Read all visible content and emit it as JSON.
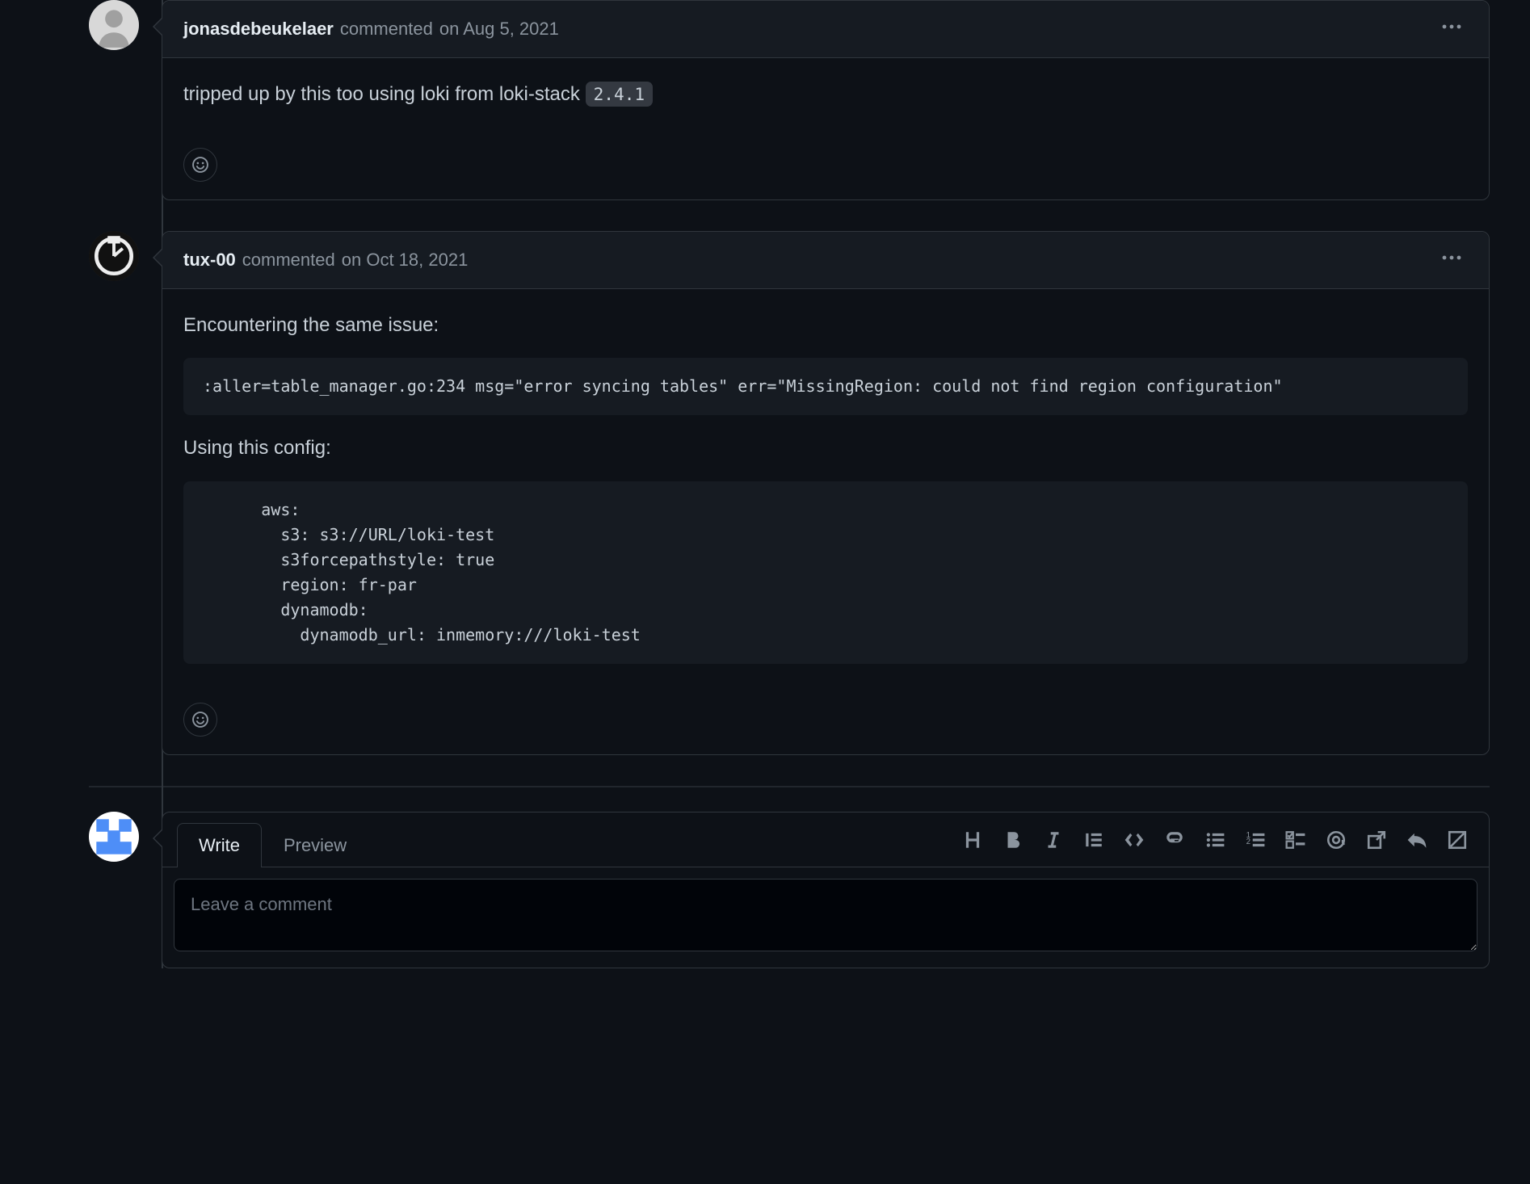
{
  "comments": [
    {
      "author": "jonasdebeukelaer",
      "commented_label": "commented",
      "date": "on Aug 5, 2021",
      "body_text": "tripped up by this too using loki from loki-stack ",
      "inline_code": "2.4.1"
    },
    {
      "author": "tux-00",
      "commented_label": "commented",
      "date": "on Oct 18, 2021",
      "p1": "Encountering the same issue:",
      "code1": ":aller=table_manager.go:234 msg=\"error syncing tables\" err=\"MissingRegion: could not find region configuration\"",
      "p2": "Using this config:",
      "code2": "      aws:\n        s3: s3://URL/loki-test\n        s3forcepathstyle: true\n        region: fr-par\n        dynamodb:\n          dynamodb_url: inmemory:///loki-test"
    }
  ],
  "newComment": {
    "tabs": {
      "write": "Write",
      "preview": "Preview"
    },
    "placeholder": "Leave a comment"
  }
}
